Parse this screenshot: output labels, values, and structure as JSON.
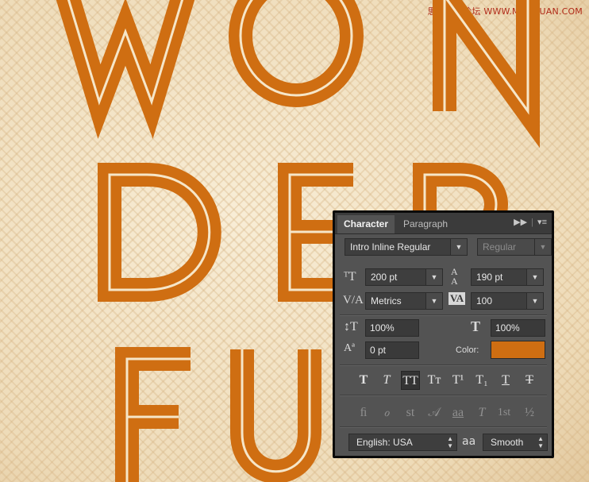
{
  "watermark": "思缘设计论坛 WWW.MISSYUAN.COM",
  "artwork": {
    "lines": [
      "WON",
      "DER",
      "FUL"
    ],
    "letter_color": "#cf6e12",
    "inline_color": "#f6e6c8",
    "background_color": "#f2e2c2"
  },
  "panel": {
    "tabs": {
      "character": "Character",
      "paragraph": "Paragraph"
    },
    "tab_icons": {
      "collapse": "double-arrow-icon",
      "menu": "panel-menu-icon"
    },
    "font_family": "Intro Inline Regular",
    "font_style": "Regular",
    "font_size": "200 pt",
    "leading": "190 pt",
    "kerning": "Metrics",
    "tracking": "100",
    "vertical_scale": "100%",
    "horizontal_scale": "100%",
    "baseline_shift": "0 pt",
    "color_label": "Color:",
    "color_value": "#cf6e12",
    "type_style_buttons": [
      {
        "name": "faux-bold",
        "glyph": "T"
      },
      {
        "name": "faux-italic",
        "glyph": "T"
      },
      {
        "name": "all-caps",
        "glyph": "TT",
        "active": true
      },
      {
        "name": "small-caps",
        "glyph": "Tт"
      },
      {
        "name": "superscript",
        "glyph": "T¹"
      },
      {
        "name": "subscript",
        "glyph": "T₁"
      },
      {
        "name": "underline",
        "glyph": "T"
      },
      {
        "name": "strikethrough",
        "glyph": "T"
      }
    ],
    "opentype_buttons": [
      {
        "name": "standard-ligatures",
        "glyph": "ﬁ"
      },
      {
        "name": "contextual-alternates",
        "glyph": "ℴ"
      },
      {
        "name": "discretionary-ligatures",
        "glyph": "st"
      },
      {
        "name": "swash",
        "glyph": "𝒜"
      },
      {
        "name": "stylistic-alternates",
        "glyph": "aa"
      },
      {
        "name": "titling-alternates",
        "glyph": "T"
      },
      {
        "name": "ordinals",
        "glyph": "1st"
      },
      {
        "name": "fractions",
        "glyph": "½"
      }
    ],
    "language": "English: USA",
    "antialias_icon": "aa",
    "antialias": "Smooth"
  }
}
